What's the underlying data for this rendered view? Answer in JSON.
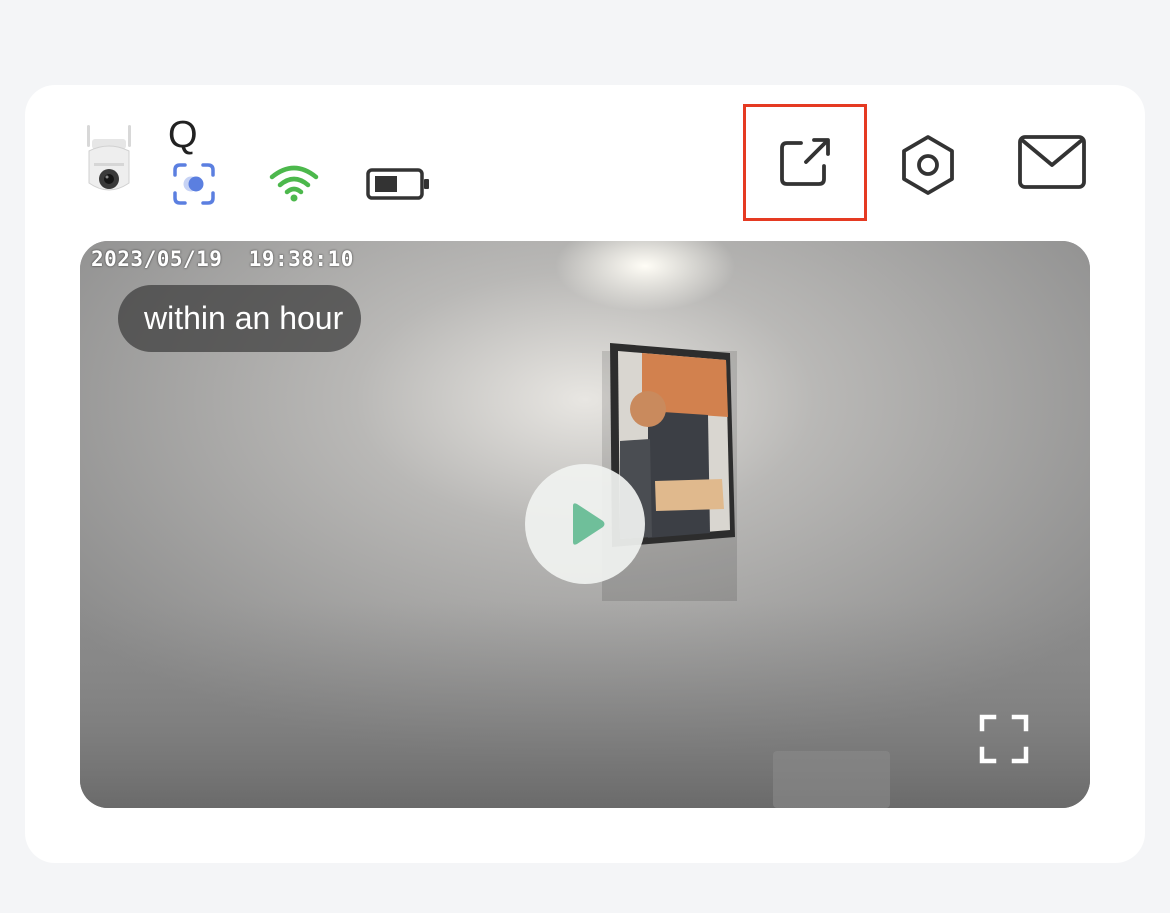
{
  "device": {
    "name": "Q",
    "thumbnail_icon": "outdoor-camera-icon",
    "status_icons": [
      {
        "name": "motion-detection-icon",
        "color": "#5b7fe0"
      },
      {
        "name": "wifi-icon",
        "color": "#4cb84c"
      },
      {
        "name": "battery-icon",
        "color": "#333333"
      }
    ]
  },
  "actions": [
    {
      "name": "share-icon",
      "highlighted": true,
      "highlight_color": "#e53a22"
    },
    {
      "name": "settings-icon"
    },
    {
      "name": "message-icon"
    }
  ],
  "video": {
    "timestamp": "2023/05/19  19:38:10",
    "time_range": "within an hour",
    "play_icon": "play-icon",
    "play_color": "#6fbf9a",
    "fullscreen_icon": "fullscreen-icon"
  }
}
